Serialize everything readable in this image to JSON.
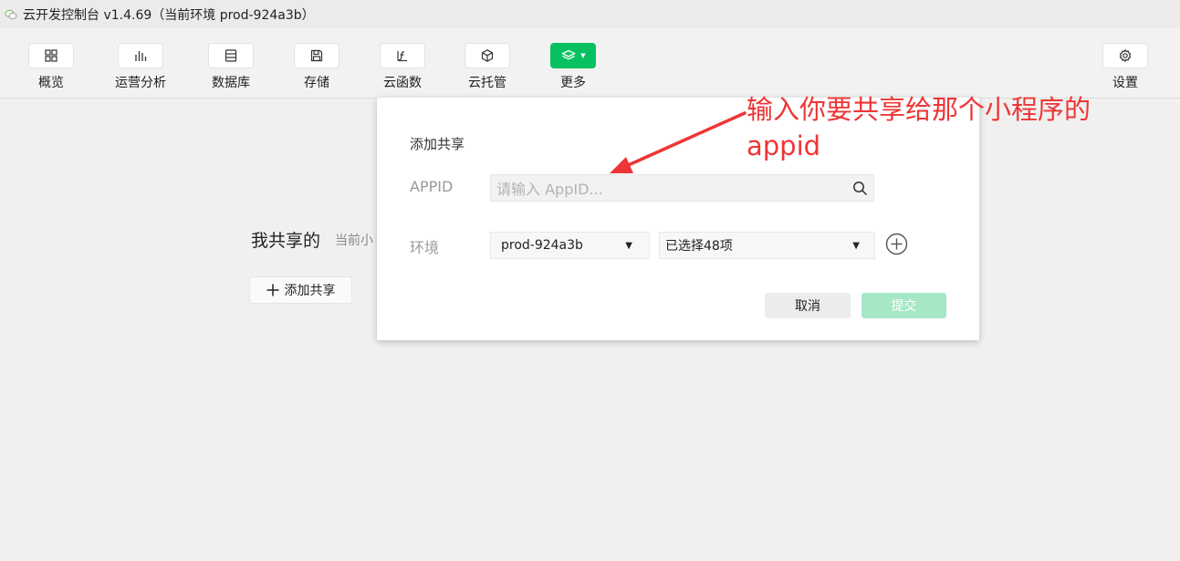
{
  "window": {
    "title": "云开发控制台 v1.4.69（当前环境 prod-924a3b）",
    "app_icon": "wechat-devtools-icon"
  },
  "toolbar": {
    "items": [
      {
        "label": "概览",
        "icon": "overview-grid-icon"
      },
      {
        "label": "运营分析",
        "icon": "bar-chart-icon"
      },
      {
        "label": "数据库",
        "icon": "database-icon"
      },
      {
        "label": "存储",
        "icon": "storage-save-icon"
      },
      {
        "label": "云函数",
        "icon": "function-icon"
      },
      {
        "label": "云托管",
        "icon": "cube-icon"
      },
      {
        "label": "更多",
        "icon": "layers-icon"
      },
      {
        "label": "设置",
        "icon": "gear-icon"
      }
    ],
    "accent": "#07c160"
  },
  "page": {
    "shared_title": "我共享的",
    "shared_subtitle": "当前小",
    "add_share_label": "添加共享"
  },
  "dialog": {
    "title": "添加共享",
    "appid_label": "APPID",
    "appid_placeholder": "请输入 AppID...",
    "env_label": "环境",
    "env_selected": "prod-924a3b",
    "scope_selected": "已选择48项",
    "cancel_label": "取消",
    "submit_label": "提交",
    "submit_color": "#a6e7c6"
  },
  "annotation": {
    "text": "输入你要共享给那个小程序的appid",
    "color": "#ee3535"
  }
}
